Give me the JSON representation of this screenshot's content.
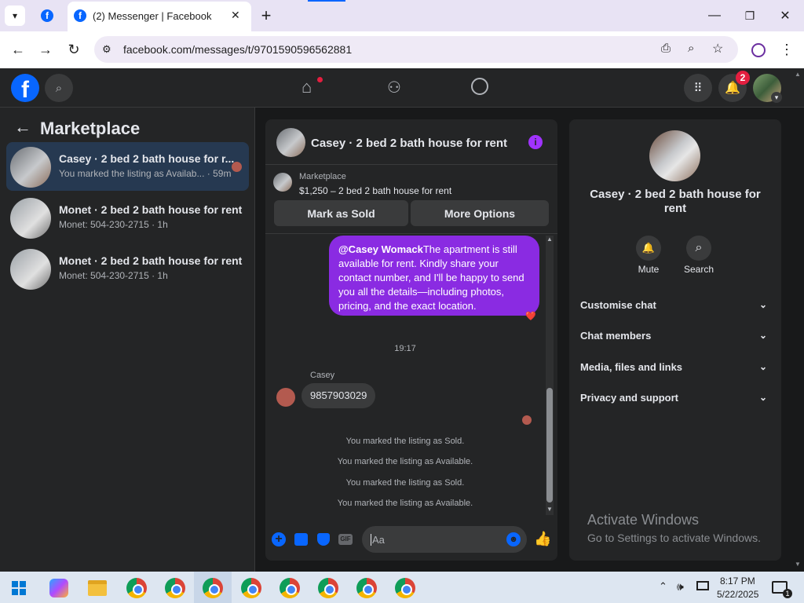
{
  "browser": {
    "tab_title": "(2) Messenger | Facebook",
    "url": "facebook.com/messages/t/9701590596562881",
    "new_tab": "+",
    "window_controls": {
      "minimize": "—",
      "maximize": "❐",
      "close": "✕"
    }
  },
  "fb_header": {
    "notification_count": "2"
  },
  "left_panel": {
    "back_arrow": "←",
    "title": "Marketplace",
    "conversations": [
      {
        "title": "Casey · 2 bed 2 bath house for r...",
        "subtitle": "You marked the listing as Availab... · 59m"
      },
      {
        "title": "Monet · 2 bed 2 bath house for rent",
        "subtitle": "Monet: 504-230-2715 · 1h"
      },
      {
        "title": "Monet · 2 bed 2 bath house for rent",
        "subtitle": "Monet: 504-230-2715 · 1h"
      }
    ]
  },
  "chat": {
    "header_title": "Casey · 2 bed 2 bath house for rent",
    "listing_source": "Marketplace",
    "listing_price": "$1,250 – 2 bed 2 bath house for rent",
    "mark_sold_label": "Mark as Sold",
    "more_options_label": "More Options",
    "sent_mention": "@Casey Womack",
    "sent_text": "The apartment is still available for rent. Kindly share your contact number, and I'll be happy to send you all the details—including photos, pricing, and the exact location.",
    "reaction": "❤️",
    "timestamp": "19:17",
    "sender_name": "Casey",
    "received_text": "9857903029",
    "system_messages": [
      "You marked the listing as Sold.",
      "You marked the listing as Available.",
      "You marked the listing as Sold.",
      "You marked the listing as Available."
    ],
    "composer_placeholder": "Aa",
    "gif_label": "GIF"
  },
  "right_panel": {
    "name": "Casey · 2 bed 2 bath house for rent",
    "mute_label": "Mute",
    "search_label": "Search",
    "sections": [
      "Customise chat",
      "Chat members",
      "Media, files and links",
      "Privacy and support"
    ]
  },
  "watermark": {
    "title": "Activate Windows",
    "subtitle": "Go to Settings to activate Windows."
  },
  "taskbar": {
    "time": "8:17 PM",
    "date": "5/22/2025",
    "notif_count": "1"
  },
  "colors": {
    "accent": "#0866ff",
    "bubble": "#8a2be2",
    "info": "#a033ff"
  }
}
